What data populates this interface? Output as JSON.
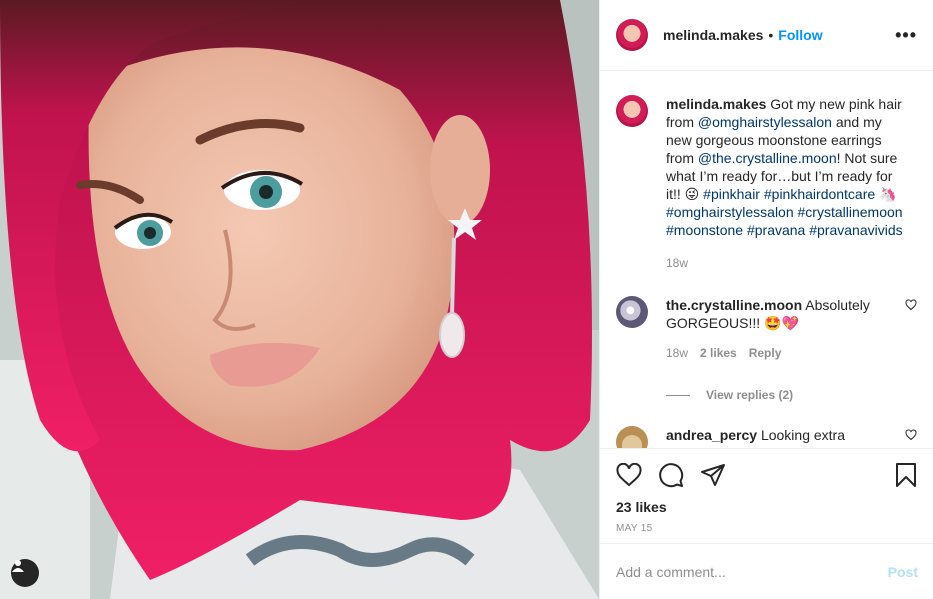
{
  "post": {
    "username": "melinda.makes",
    "follow_label": "Follow",
    "separator": "•",
    "more_label": "•••"
  },
  "caption": {
    "username": "melinda.makes",
    "segments": [
      {
        "text": "Got my new pink hair from ",
        "type": "text"
      },
      {
        "text": "@omghairstylessalon",
        "type": "link"
      },
      {
        "text": " and my new gorgeous moonstone earrings from ",
        "type": "text"
      },
      {
        "text": "@the.crystalline.moon",
        "type": "link"
      },
      {
        "text": "! Not sure what I’m ready for…but I’m ready for it!! 😜 ",
        "type": "text"
      },
      {
        "text": "#pinkhair",
        "type": "link"
      },
      {
        "text": " ",
        "type": "text"
      },
      {
        "text": "#pinkhairdontcare",
        "type": "link"
      },
      {
        "text": " 🦄 ",
        "type": "text"
      },
      {
        "text": "#omghairstylessalon",
        "type": "link"
      },
      {
        "text": " ",
        "type": "text"
      },
      {
        "text": "#crystallinemoon",
        "type": "link"
      },
      {
        "text": " ",
        "type": "text"
      },
      {
        "text": "#moonstone",
        "type": "link"
      },
      {
        "text": " ",
        "type": "text"
      },
      {
        "text": "#pravana",
        "type": "link"
      },
      {
        "text": " ",
        "type": "text"
      },
      {
        "text": "#pravanavivids",
        "type": "link"
      }
    ],
    "time": "18w"
  },
  "comments": [
    {
      "username": "the.crystalline.moon",
      "text": "Absolutely GORGEOUS!!! 🤩💖",
      "time": "18w",
      "likes": "2 likes",
      "reply_label": "Reply",
      "view_replies": "View replies (2)"
    },
    {
      "username": "andrea_percy",
      "text": "Looking extra"
    }
  ],
  "footer": {
    "likes": "23 likes",
    "date": "MAY 15",
    "comment_placeholder": "Add a comment...",
    "post_label": "Post"
  },
  "icons": {
    "like": "heart-icon",
    "comment": "comment-icon",
    "share": "share-icon",
    "save": "bookmark-icon",
    "tag": "user-tag-icon"
  },
  "colors": {
    "accent": "#0095f6",
    "link": "#00376b",
    "hair": "#e0155a",
    "muted": "#8e8e8e"
  }
}
